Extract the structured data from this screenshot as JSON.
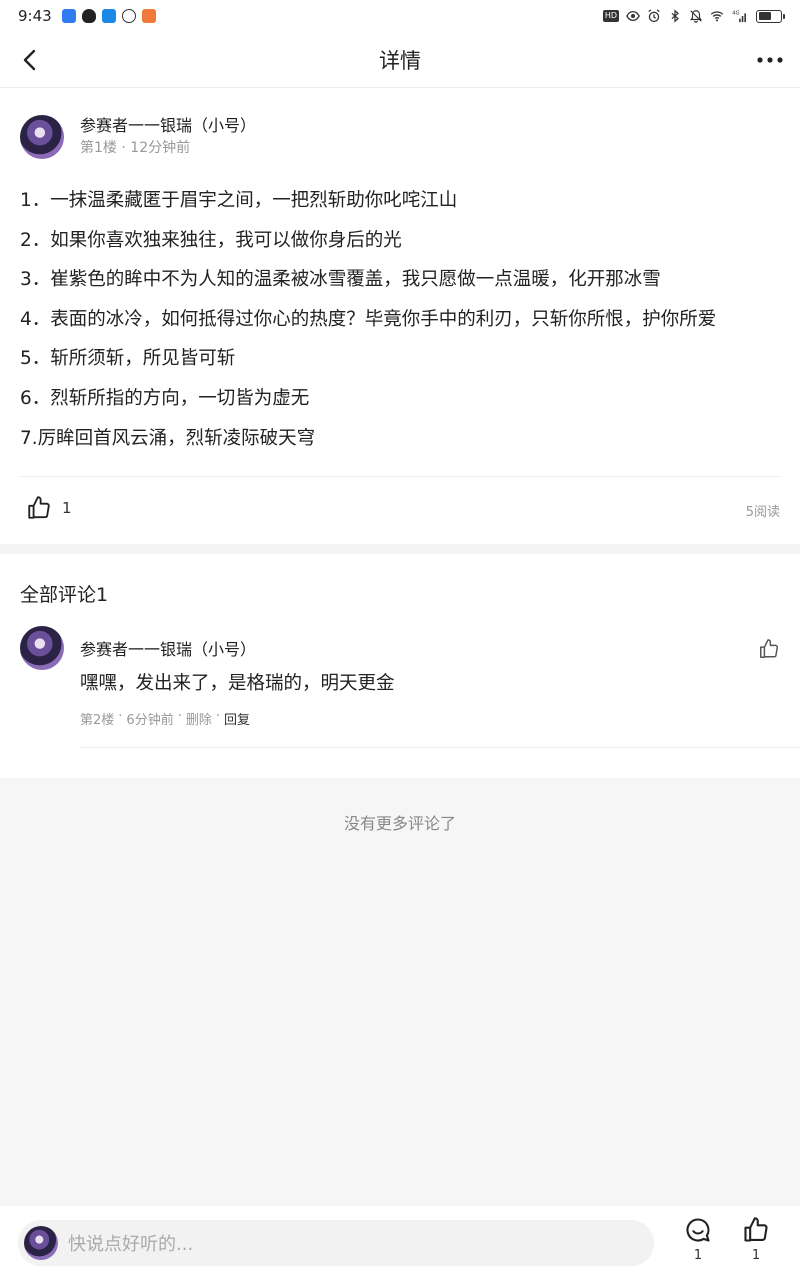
{
  "status_bar": {
    "time": "9:43",
    "network": "4G",
    "hd": "HD",
    "battery_percent": 60
  },
  "nav": {
    "title": "详情"
  },
  "post": {
    "author": "参赛者一一银瑞（小号）",
    "floor": "第1楼",
    "time": "12分钟前",
    "lines": [
      "1．一抹温柔藏匿于眉宇之间，一把烈斩助你叱咤江山",
      "2．如果你喜欢独来独往，我可以做你身后的光",
      "3．崔紫色的眸中不为人知的温柔被冰雪覆盖，我只愿做一点温暖，化开那冰雪",
      "4．表面的冰冷，如何抵得过你心的热度？毕竟你手中的利刃，只斩你所恨，护你所爱",
      "5．斩所须斩，所见皆可斩",
      "6．烈斩所指的方向，一切皆为虚无",
      "7.厉眸回首风云涌，烈斩凌际破天穹"
    ],
    "like_count": "1",
    "reads": "5阅读"
  },
  "comments": {
    "title": "全部评论1",
    "items": [
      {
        "author": "参赛者一一银瑞（小号）",
        "text": "嘿嘿，发出来了，是格瑞的，明天更金",
        "floor": "第2楼",
        "time": "6分钟前",
        "delete": "删除",
        "reply": "回复"
      }
    ]
  },
  "no_more": "没有更多评论了",
  "bottom_bar": {
    "placeholder": "快说点好听的...",
    "comment_count": "1",
    "like_count": "1"
  },
  "colors": {
    "text": "#222222",
    "secondary": "#999999",
    "divider": "#eeeeee",
    "section_bg": "#f6f6f6"
  }
}
